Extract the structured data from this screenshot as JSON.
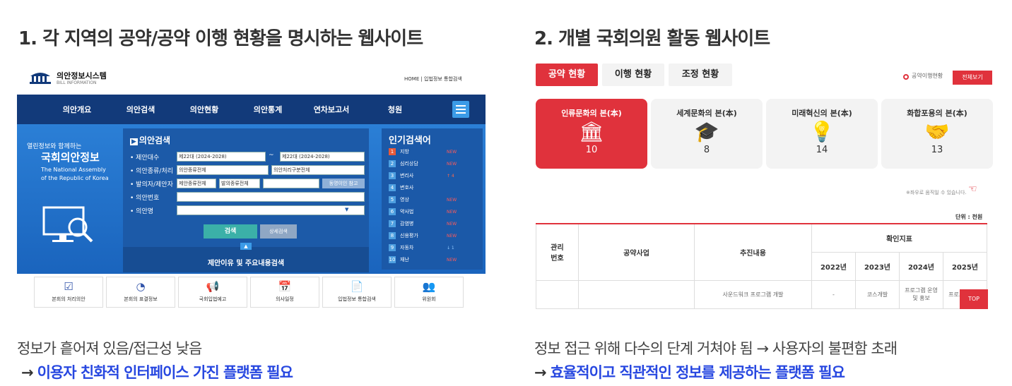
{
  "sections": [
    {
      "heading": "1. 각 지역의 공약/공약 이행 현황을 명시하는 웹사이트",
      "note": "정보가 흩어져 있음/접근성 낮음",
      "conclusion": "이용자 친화적 인터페이스 가진 플랫폼 필요"
    },
    {
      "heading": "2. 개별 국회의원 활동 웹사이트",
      "note": "정보 접근 위해 다수의 단계 거쳐야 됨 → 사용자의 불편함 초래",
      "conclusion": "효율적이고 직관적인 정보를 제공하는 플랫폼 필요"
    }
  ],
  "arrow": "→",
  "left_site": {
    "logo_title": "의안정보시스템",
    "logo_sub": "BILL INFORMATION",
    "top_links": "HOME | 입법정보 통합검색",
    "nav": [
      "의안개요",
      "의안검색",
      "의안현황",
      "의안통계",
      "연차보고서",
      "청원"
    ],
    "banner": {
      "tagline": "열린정보와 함께하는",
      "title": "국회의안정보",
      "en1": "The National Assembly",
      "en2": "of the Republic of Korea"
    },
    "search": {
      "title": "의안검색",
      "rows": [
        "제안대수",
        "의안종류/처리",
        "발의자/제안자",
        "의안번호",
        "의안명"
      ],
      "age_from": "제22대 (2024-2028)",
      "age_to": "제22대 (2024-2028)",
      "tilde": "~",
      "kind": "의안종류전체",
      "process": "의안처리구분전체",
      "proposer_type": "제안종류전체",
      "proposer_kind": "발의종류전체",
      "same_name": "동명이인 참고",
      "search_btn": "검색",
      "detail_btn": "상세검색",
      "reason_search": "제안이유 및 주요내용검색"
    },
    "popular": {
      "title": "인기검색어",
      "items": [
        {
          "rank": "1",
          "word": "지방",
          "trend": "NEW"
        },
        {
          "rank": "2",
          "word": "심리상담",
          "trend": "NEW"
        },
        {
          "rank": "3",
          "word": "변리사",
          "trend": "↑ 4"
        },
        {
          "rank": "4",
          "word": "변호사",
          "trend": ""
        },
        {
          "rank": "5",
          "word": "영상",
          "trend": "NEW"
        },
        {
          "rank": "6",
          "word": "약사법",
          "trend": "NEW"
        },
        {
          "rank": "7",
          "word": "감염병",
          "trend": "NEW"
        },
        {
          "rank": "8",
          "word": "신용평가",
          "trend": "NEW"
        },
        {
          "rank": "9",
          "word": "자동차",
          "trend": "↓ 1"
        },
        {
          "rank": "10",
          "word": "재난",
          "trend": "NEW"
        }
      ]
    },
    "quick": [
      "본회의 처리의안",
      "본회의 표결정보",
      "국회입법예고",
      "의사일정",
      "입법정보 통합검색",
      "위원회"
    ]
  },
  "right_site": {
    "tabs": [
      "공약 현황",
      "이행 현황",
      "조정 현황"
    ],
    "legend": "공약이행현황",
    "view_all": "전체보기",
    "cards": [
      {
        "title": "인류문화의 본(本)",
        "count": "10",
        "icon": "building-icon"
      },
      {
        "title": "세계문화의 본(本)",
        "count": "8",
        "icon": "graduation-icon"
      },
      {
        "title": "미래혁신의 본(本)",
        "count": "14",
        "icon": "lightbulb-gear-icon"
      },
      {
        "title": "화합포용의 본(本)",
        "count": "13",
        "icon": "handshake-icon"
      }
    ],
    "scroll_hint": "※좌우로 움직일 수 있습니다.",
    "unit": "단위 : 천원",
    "table": {
      "col_no": "관리\n번호",
      "col_project": "공약사업",
      "col_content": "추진내용",
      "col_indicator": "확인지표",
      "years": [
        "2022년",
        "2023년",
        "2024년",
        "2025년"
      ],
      "row1": [
        "",
        "",
        "사운드워크 프로그램 개발",
        "-",
        "코스개발",
        "프로그램 운영 및 홍보",
        "프로그램 운영"
      ]
    },
    "top_btn": "TOP"
  }
}
